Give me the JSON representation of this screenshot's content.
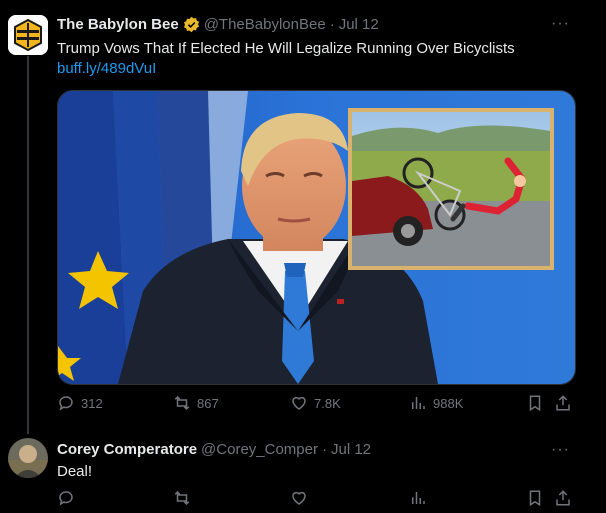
{
  "tweet": {
    "author": "The Babylon Bee",
    "handle": "@TheBabylonBee",
    "date": "Jul 12",
    "text": "Trump Vows That If Elected He Will Legalize Running Over Bicyclists",
    "link": "buff.ly/489dVuI",
    "replies": "312",
    "retweets": "867",
    "likes": "7.8K",
    "views": "988K"
  },
  "reply": {
    "author": "Corey Comperatore",
    "handle": "@Corey_Comper",
    "date": "Jul 12",
    "text": "Deal!"
  },
  "icons": {
    "more": "more-icon",
    "verified": "verified-badge-icon",
    "reply": "reply-icon",
    "retweet": "retweet-icon",
    "like": "like-icon",
    "views": "views-icon",
    "bookmark": "bookmark-icon",
    "share": "share-icon"
  },
  "colors": {
    "background": "#000000",
    "text": "#e7e9ea",
    "muted": "#71767b",
    "link": "#1d9bf0",
    "verified": "#e8b92b"
  }
}
